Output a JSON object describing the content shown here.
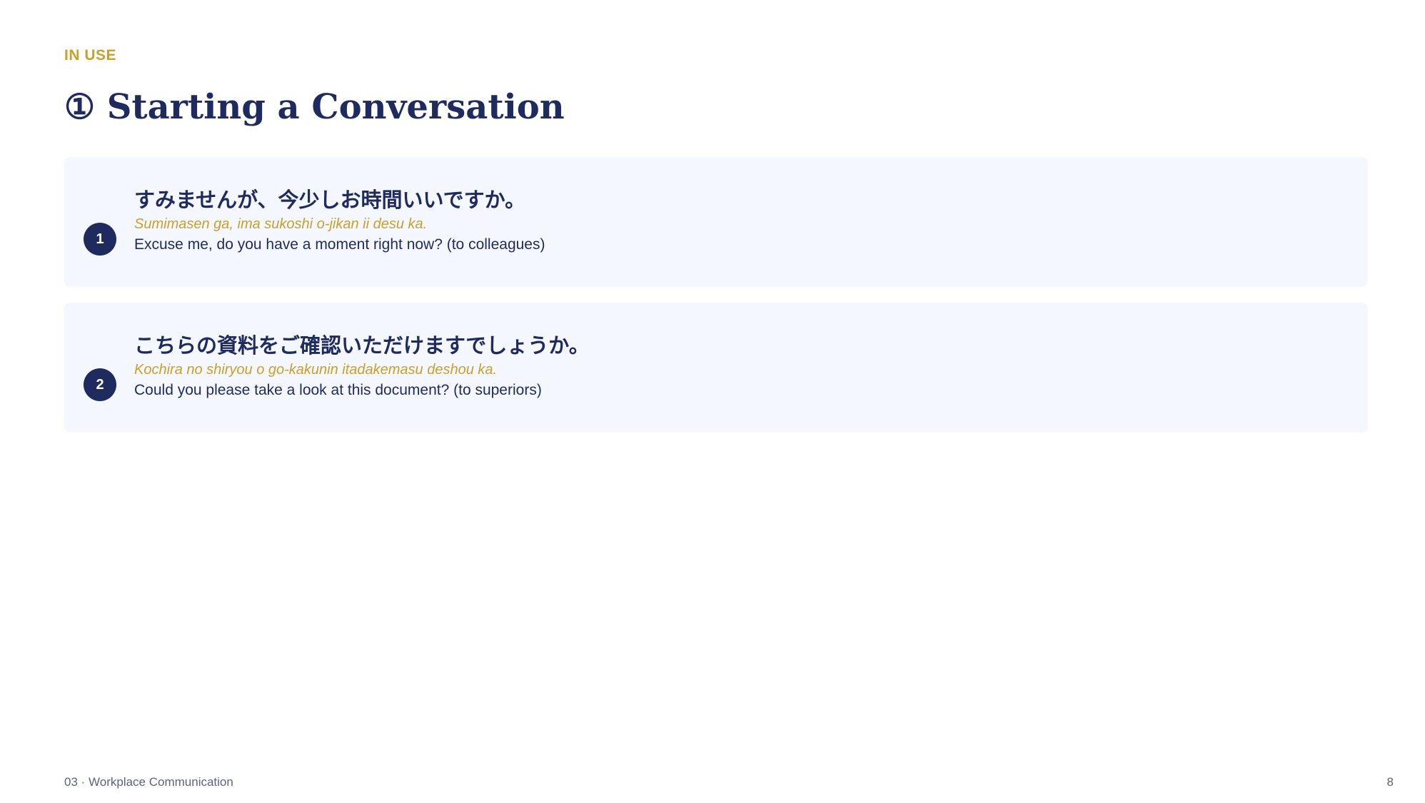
{
  "eyebrow": "IN USE",
  "title": "① Starting a Conversation",
  "colors": {
    "accent": "#c9a02a",
    "navy": "#1f2a5e",
    "card_background": "#f4f8fe"
  },
  "phrases": [
    {
      "number": "1",
      "japanese": "すみませんが、今少しお時間いいですか。",
      "romaji": "Sumimasen ga, ima sukoshi o-jikan ii desu ka.",
      "english": "Excuse me, do you have a moment right now? (to colleagues)"
    },
    {
      "number": "2",
      "japanese": "こちらの資料をご確認いただけますでしょうか。",
      "romaji": "Kochira no shiryou o go-kakunin itadakemasu deshou ka.",
      "english": "Could you please take a look at this document? (to superiors)"
    }
  ],
  "footer": {
    "section": "03 · Workplace Communication",
    "page_number": "8"
  }
}
